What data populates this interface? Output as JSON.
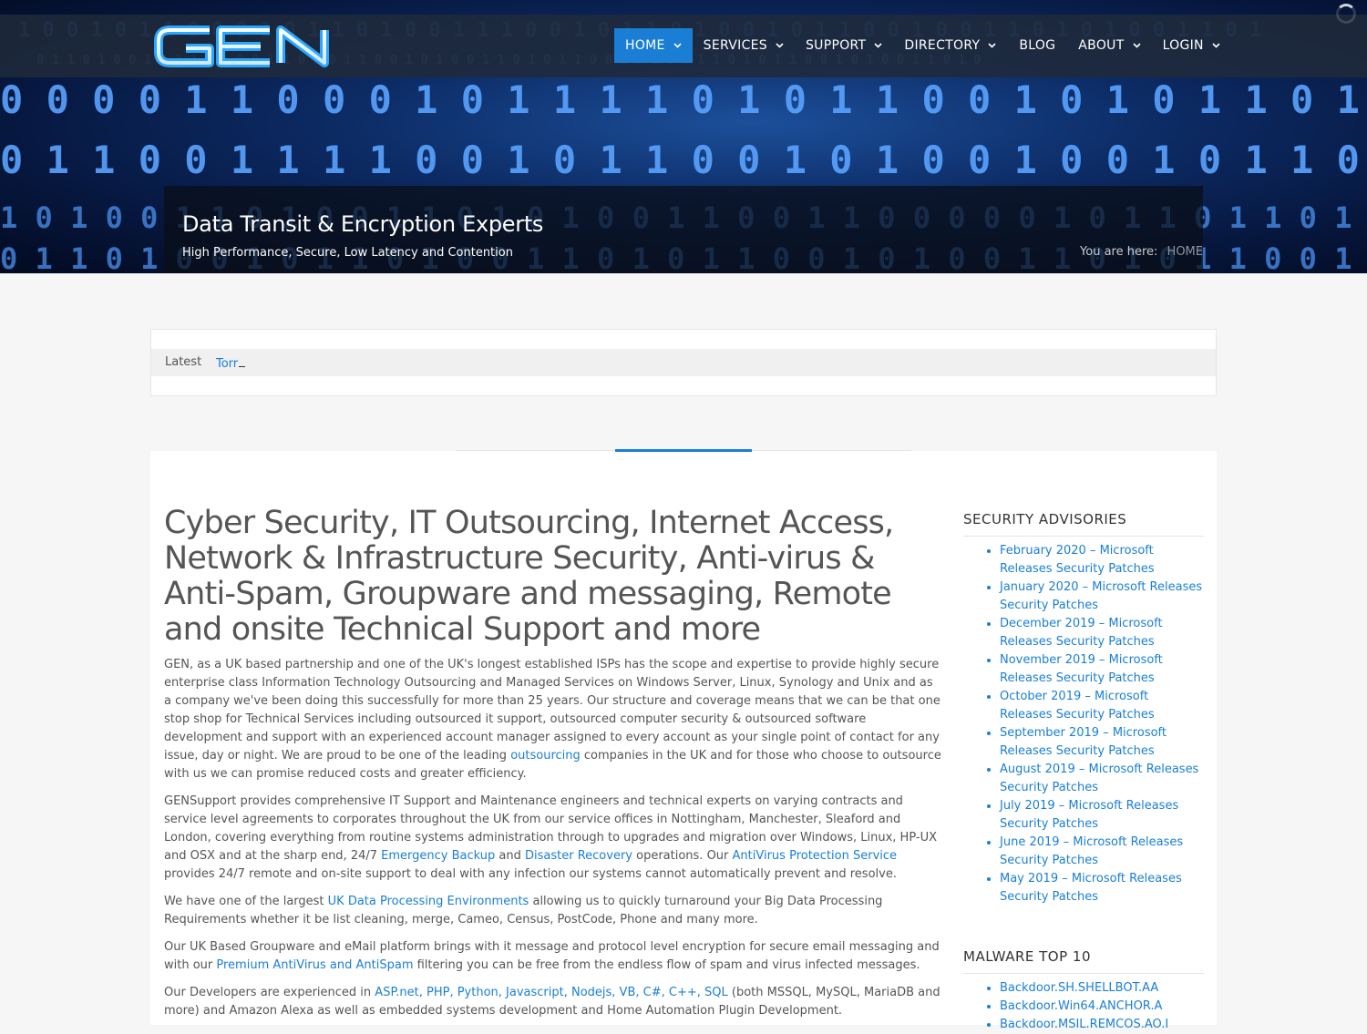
{
  "brand": {
    "logo_text": "GEN"
  },
  "nav": [
    {
      "label": "HOME",
      "has_dropdown": true,
      "active": true
    },
    {
      "label": "SERVICES",
      "has_dropdown": true
    },
    {
      "label": "SUPPORT",
      "has_dropdown": true
    },
    {
      "label": "DIRECTORY",
      "has_dropdown": true
    },
    {
      "label": "BLOG",
      "has_dropdown": false
    },
    {
      "label": "ABOUT",
      "has_dropdown": true
    },
    {
      "label": "LOGIN",
      "has_dropdown": true
    }
  ],
  "hero": {
    "title": "Data Transit & Encryption Experts",
    "subtitle": "High Performance, Secure, Low Latency and Contention",
    "breadcrumb_prefix": "You are here:",
    "breadcrumb_current": "HOME"
  },
  "ticker": {
    "label": "Latest",
    "item": "Torr"
  },
  "main": {
    "headline": "Cyber Security, IT Outsourcing, Internet Access, Network & Infrastructure Security, Anti-virus & Anti-Spam, Groupware and messaging, Remote and onsite Technical Support and more",
    "p1": {
      "text_a": "GEN, as a UK based partnership and one of the UK's longest established ISPs has the scope and expertise to provide highly secure enterprise class Information Technology Outsourcing and Managed Services on Windows Server, Linux, Synology and Unix and as a company we've been doing this successfully for more than 25 years. Our structure and coverage means that we can be that one stop shop for Technical  Services including outsourced it support, outsourced computer security & outsourced software development and support with an experienced account manager assigned to every account as your single point of contact for any issue, day or night. We are proud to be one of the leading ",
      "link": "outsourcing",
      "text_b": " companies in the UK and for those who choose to outsource with us we can promise reduced costs and greater efficiency."
    },
    "p2": {
      "text_a": "GENSupport provides comprehensive IT Support and Maintenance engineers and technical experts on varying contracts and service level agreements to corporates throughout the UK from our service offices in Nottingham, Manchester, Sleaford and London, covering everything from routine systems administration through to upgrades and migration over Windows, Linux, HP-UX and OSX and at the sharp end, 24/7 ",
      "link1": "Emergency Backup",
      "text_b": " and ",
      "link2": "Disaster Recovery",
      "text_c": " operations. Our ",
      "link3": "AntiVirus Protection Service",
      "text_d": " provides 24/7 remote and on-site support to deal with any infection our systems cannot automatically prevent and resolve."
    },
    "p3": {
      "text_a": "We have one of the largest ",
      "link": "UK Data Processing Environments",
      "text_b": " allowing us to quickly turnaround your Big Data Processing Requirements whether it be list cleaning, merge, Cameo, Census, PostCode, Phone and many more."
    },
    "p4": {
      "text_a": "Our UK Based Groupware and eMail platform brings with it message and protocol level encryption for secure email messaging and with our ",
      "link": "Premium AntiVirus and AntiSpam",
      "text_b": " filtering you can be free from the endless flow of spam and virus infected messages."
    },
    "p5": {
      "text_a": "Our Developers are experienced in ",
      "link": "ASP.net, PHP, Python, Javascript, Nodejs, VB, C#, C++, SQL",
      "text_b": " (both MSSQL, MySQL, MariaDB and more) and Amazon Alexa as well as embedded systems development and Home Automation Plugin Development."
    }
  },
  "sidebar": {
    "advisories": {
      "title": "SECURITY ADVISORIES",
      "items": [
        "February 2020 – Microsoft Releases Security Patches",
        "January 2020 – Microsoft Releases Security Patches",
        "December 2019 – Microsoft Releases Security Patches",
        "November 2019 – Microsoft Releases Security Patches",
        "October 2019 – Microsoft Releases Security Patches",
        "September 2019 – Microsoft Releases Security Patches",
        "August 2019 – Microsoft Releases Security Patches",
        "July 2019 – Microsoft Releases Security Patches",
        "June 2019 – Microsoft Releases Security Patches",
        "May 2019 – Microsoft Releases Security Patches"
      ]
    },
    "malware": {
      "title": "MALWARE TOP 10",
      "items": [
        "Backdoor.SH.SHELLBOT.AA",
        "Backdoor.Win64.ANCHOR.A",
        "Backdoor.MSIL.REMCOS.AO.I"
      ]
    }
  },
  "colors": {
    "accent": "#1a7fd4",
    "topbar": "#202a3a"
  },
  "icons": {
    "nav_dropdown": "chevron-down-icon",
    "loader": "spinner-icon"
  }
}
